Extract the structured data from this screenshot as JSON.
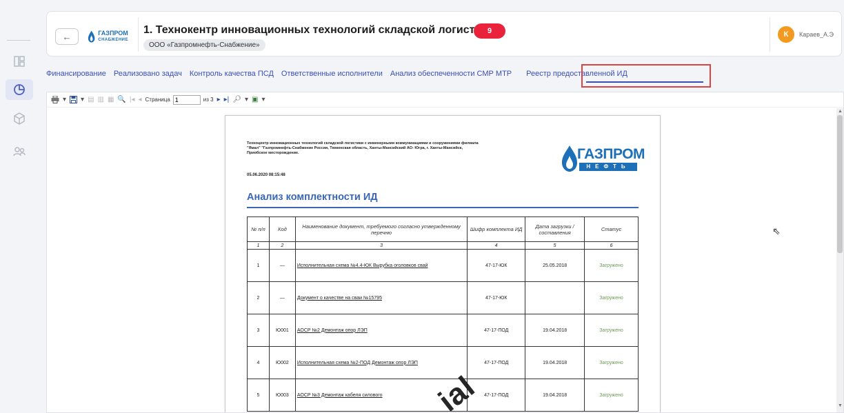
{
  "header": {
    "back_label": "←",
    "logo_text": "ГАЗПРОМ",
    "logo_sub": "СНАБЖЕНИЕ",
    "title": "1. Технокентр инновационных технологий складской логистики",
    "badge_count": "9",
    "org": "ООО «Газпромнефть-Снабжение»",
    "user_initial": "К",
    "user_name": "Караев_А.Э"
  },
  "tabs": [
    {
      "label": "Финансирование"
    },
    {
      "label": "Реализовано задач"
    },
    {
      "label": "Контроль качества ПСД"
    },
    {
      "label": "Ответственные исполнители"
    },
    {
      "label": "Анализ обеспеченности СМР МТР"
    },
    {
      "label": "Реестр предоставленной ИД",
      "active": true
    }
  ],
  "toolbar": {
    "page_label": "Страница",
    "page_value": "1",
    "page_of": "из 3"
  },
  "document": {
    "header_text": "Техноцентр инновационных технологий складской логистики с инженерными коммуникациями и сооружениями филиала \"Ямал\" \"Газпромнефть-Снабжение Россия, Тюменская область, Ханты-Мансийский АО- Югра, г. Ханты-Мансийск, Приобское месторождение.",
    "date": "05.06.2020 08:15:48",
    "logo_text": "ГАЗПРОМ",
    "logo_sub": "НЕФТЬ",
    "title": "Анализ комплектности ИД",
    "columns": [
      "№ п/п",
      "Код",
      "Наименование документ, требуемого согласно утвержденному перечню",
      "Шифр комплекта ИД",
      "Дата загрузки / составления",
      "Статус"
    ],
    "column_numbers": [
      "1",
      "2",
      "3",
      "4",
      "5",
      "6"
    ],
    "rows": [
      {
        "n": "1",
        "code": "—",
        "name": "Исполнительная схема №4.4-ЮК Вырубка оголовков свай",
        "cipher": "47-17-ЮК",
        "date": "25.05.2018",
        "status": "Загружено"
      },
      {
        "n": "2",
        "code": "—",
        "name": "Документ о качестве на сваи №15795",
        "cipher": "47-17-ЮК",
        "date": "",
        "status": "Загружено"
      },
      {
        "n": "3",
        "code": "Ю001",
        "name": "АОСР №2 Демонтаж опор ЛЭП",
        "cipher": "47-17-ПОД",
        "date": "19.04.2018",
        "status": "Загружено"
      },
      {
        "n": "4",
        "code": "Ю002",
        "name": "Исполнительная схема №2-ПОД Демонтаж опор ЛЭП",
        "cipher": "47-17-ПОД",
        "date": "19.04.2018",
        "status": "Загружено"
      },
      {
        "n": "5",
        "code": "Ю003",
        "name": "АОСР №3 Демонтаж кабеля силового",
        "cipher": "47-17-ПОД",
        "date": "19.04.2018",
        "status": "Загружено"
      }
    ],
    "watermark": "ial"
  }
}
